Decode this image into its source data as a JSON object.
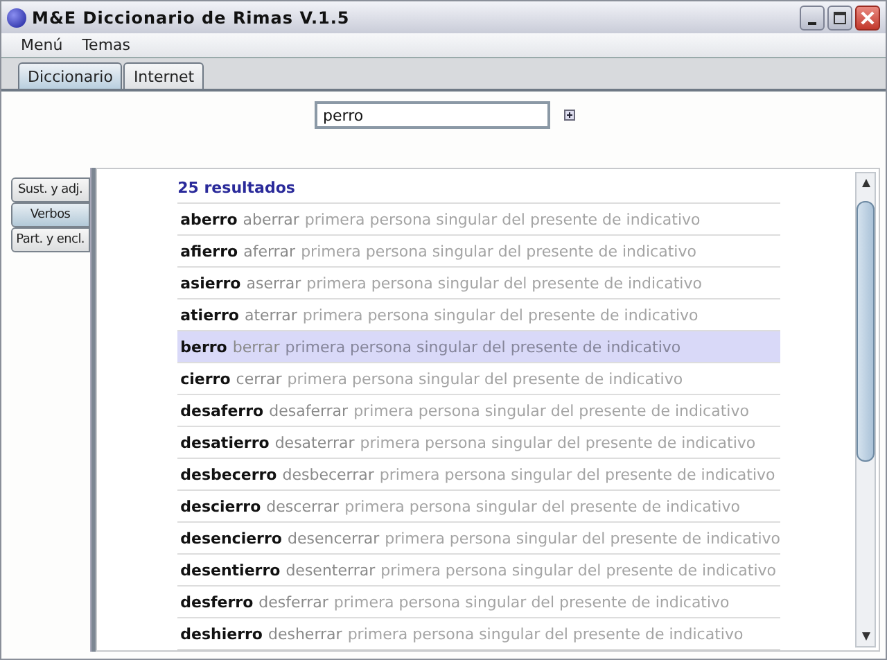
{
  "window": {
    "title": "M&E Diccionario de Rimas V.1.5"
  },
  "menu": [
    "Menú",
    "Temas"
  ],
  "tabs": [
    {
      "label": "Diccionario",
      "selected": true
    },
    {
      "label": "Internet",
      "selected": false
    }
  ],
  "search": {
    "value": "perro"
  },
  "side_tabs": [
    {
      "label": "Sust. y adj.",
      "selected": false
    },
    {
      "label": "Verbos",
      "selected": true
    },
    {
      "label": "Part. y encl.",
      "selected": false
    }
  ],
  "results_count": "25 resultados",
  "results": [
    {
      "word": "aberro",
      "verb": "aberrar",
      "description": "primera persona singular del presente de indicativo",
      "selected": false
    },
    {
      "word": "afierro",
      "verb": "aferrar",
      "description": "primera persona singular del presente de indicativo",
      "selected": false
    },
    {
      "word": "asierro",
      "verb": "aserrar",
      "description": "primera persona singular del presente de indicativo",
      "selected": false
    },
    {
      "word": "atierro",
      "verb": "aterrar",
      "description": "primera persona singular del presente de indicativo",
      "selected": false
    },
    {
      "word": "berro",
      "verb": "berrar",
      "description": "primera persona singular del presente de indicativo",
      "selected": true
    },
    {
      "word": "cierro",
      "verb": "cerrar",
      "description": "primera persona singular del presente de indicativo",
      "selected": false
    },
    {
      "word": "desaferro",
      "verb": "desaferrar",
      "description": "primera persona singular del presente de indicativo",
      "selected": false
    },
    {
      "word": "desatierro",
      "verb": "desaterrar",
      "description": "primera persona singular del presente de indicativo",
      "selected": false
    },
    {
      "word": "desbecerro",
      "verb": "desbecerrar",
      "description": "primera persona singular del presente de indicativo",
      "selected": false
    },
    {
      "word": "descierro",
      "verb": "descerrar",
      "description": "primera persona singular del presente de indicativo",
      "selected": false
    },
    {
      "word": "desencierro",
      "verb": "desencerrar",
      "description": "primera persona singular del presente de indicativo",
      "selected": false
    },
    {
      "word": "desentierro",
      "verb": "desenterrar",
      "description": "primera persona singular del presente de indicativo",
      "selected": false
    },
    {
      "word": "desferro",
      "verb": "desferrar",
      "description": "primera persona singular del presente de indicativo",
      "selected": false
    },
    {
      "word": "deshierro",
      "verb": "desherrar",
      "description": "primera persona singular del presente de indicativo",
      "selected": false
    }
  ]
}
